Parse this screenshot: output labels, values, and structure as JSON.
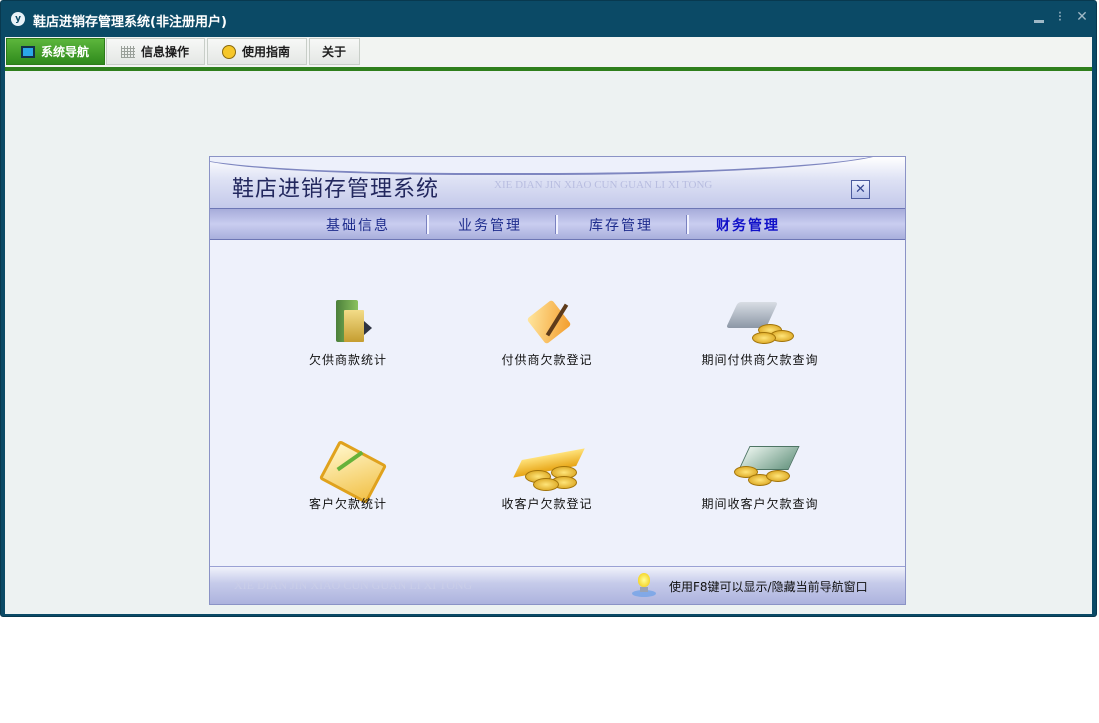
{
  "window": {
    "icon_glyph": "y",
    "title": "鞋店进销存管理系统(非注册用户)",
    "controls": {
      "minimize": "",
      "restore": "⁝",
      "close": "✕"
    }
  },
  "menubar": {
    "tabs": [
      {
        "label": "系统导航",
        "icon": "monitor-icon",
        "active": true
      },
      {
        "label": "信息操作",
        "icon": "grid-icon",
        "active": false
      },
      {
        "label": "使用指南",
        "icon": "compass-icon",
        "active": false
      },
      {
        "label": "关于",
        "icon": "",
        "active": false
      }
    ]
  },
  "nav_panel": {
    "title": "鞋店进销存管理系统",
    "subtitle": "XIE DIAN JIN XIAO CUN GUAN LI XI TONG",
    "close_glyph": "✕",
    "tabs": [
      {
        "label": "基础信息",
        "selected": false
      },
      {
        "label": "业务管理",
        "selected": false
      },
      {
        "label": "库存管理",
        "selected": false
      },
      {
        "label": "财务管理",
        "selected": true
      }
    ],
    "items": [
      {
        "label": "欠供商款统计",
        "icon": "folder-icon"
      },
      {
        "label": "付供商欠款登记",
        "icon": "document-pen-icon"
      },
      {
        "label": "期间付供商欠款查询",
        "icon": "calculator-coins-icon"
      },
      {
        "label": "客户欠款统计",
        "icon": "ledger-icon"
      },
      {
        "label": "收客户欠款登记",
        "icon": "coins-icon"
      },
      {
        "label": "期间收客户欠款查询",
        "icon": "cash-coins-icon"
      }
    ],
    "footer": {
      "watermark": "XIE DIAN JIN XIAO CUN GUAN LI XI TONG",
      "hint": "使用F8键可以显示/隐藏当前导航窗口"
    }
  },
  "colors": {
    "window_frame": "#0b4a66",
    "active_tab": "#3a9a26",
    "menu_underline": "#2f7f1d",
    "panel_accent": "#8b93c6",
    "selected_nav_tab": "#1010c8"
  }
}
